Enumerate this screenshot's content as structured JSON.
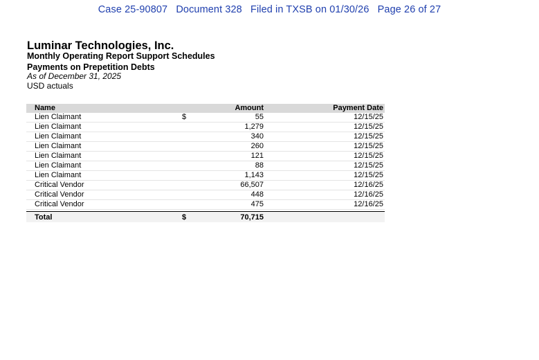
{
  "court_header": {
    "case": "Case 25-90807",
    "document": "Document 328",
    "filed": "Filed in TXSB on 01/30/26",
    "page": "Page 26 of 27"
  },
  "report": {
    "company": "Luminar Technologies, Inc.",
    "title_line1": "Monthly Operating Report Support Schedules",
    "title_line2": "Payments on Prepetition Debts",
    "as_of": "As of December 31, 2025",
    "currency_note": "USD actuals"
  },
  "table": {
    "headers": {
      "name": "Name",
      "amount": "Amount",
      "date": "Payment Date"
    },
    "rows": [
      {
        "name": "Lien Claimant",
        "currency": "$",
        "amount": "55",
        "date": "12/15/25"
      },
      {
        "name": "Lien Claimant",
        "currency": "",
        "amount": "1,279",
        "date": "12/15/25"
      },
      {
        "name": "Lien Claimant",
        "currency": "",
        "amount": "340",
        "date": "12/15/25"
      },
      {
        "name": "Lien Claimant",
        "currency": "",
        "amount": "260",
        "date": "12/15/25"
      },
      {
        "name": "Lien Claimant",
        "currency": "",
        "amount": "121",
        "date": "12/15/25"
      },
      {
        "name": "Lien Claimant",
        "currency": "",
        "amount": "88",
        "date": "12/15/25"
      },
      {
        "name": "Lien Claimant",
        "currency": "",
        "amount": "1,143",
        "date": "12/15/25"
      },
      {
        "name": "Critical Vendor",
        "currency": "",
        "amount": "66,507",
        "date": "12/16/25"
      },
      {
        "name": "Critical Vendor",
        "currency": "",
        "amount": "448",
        "date": "12/16/25"
      },
      {
        "name": "Critical Vendor",
        "currency": "",
        "amount": "475",
        "date": "12/16/25"
      }
    ],
    "total": {
      "label": "Total",
      "currency": "$",
      "amount": "70,715"
    }
  }
}
